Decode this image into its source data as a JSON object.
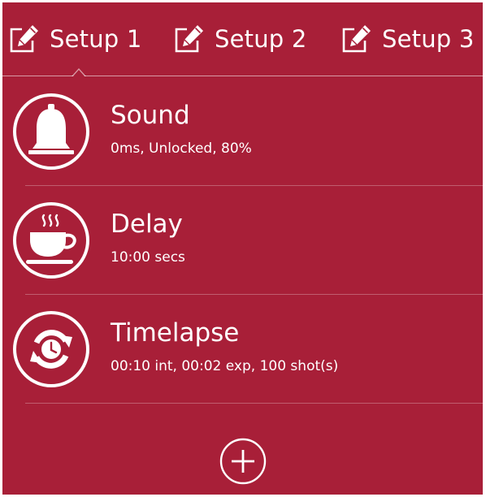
{
  "colors": {
    "background": "#a81f38",
    "foreground": "#ffffff"
  },
  "tabs": [
    {
      "label": "Setup 1",
      "icon": "edit-icon",
      "selected": true
    },
    {
      "label": "Setup 2",
      "icon": "edit-icon",
      "selected": false
    },
    {
      "label": "Setup 3",
      "icon": "edit-icon",
      "selected": false
    }
  ],
  "items": [
    {
      "title": "Sound",
      "subtitle": "0ms, Unlocked, 80%",
      "icon": "bell-icon"
    },
    {
      "title": "Delay",
      "subtitle": "10:00 secs",
      "icon": "coffee-cup-icon"
    },
    {
      "title": "Timelapse",
      "subtitle": "00:10 int, 00:02 exp, 100 shot(s)",
      "icon": "timelapse-icon"
    }
  ],
  "add_button": {
    "icon": "plus-icon"
  }
}
